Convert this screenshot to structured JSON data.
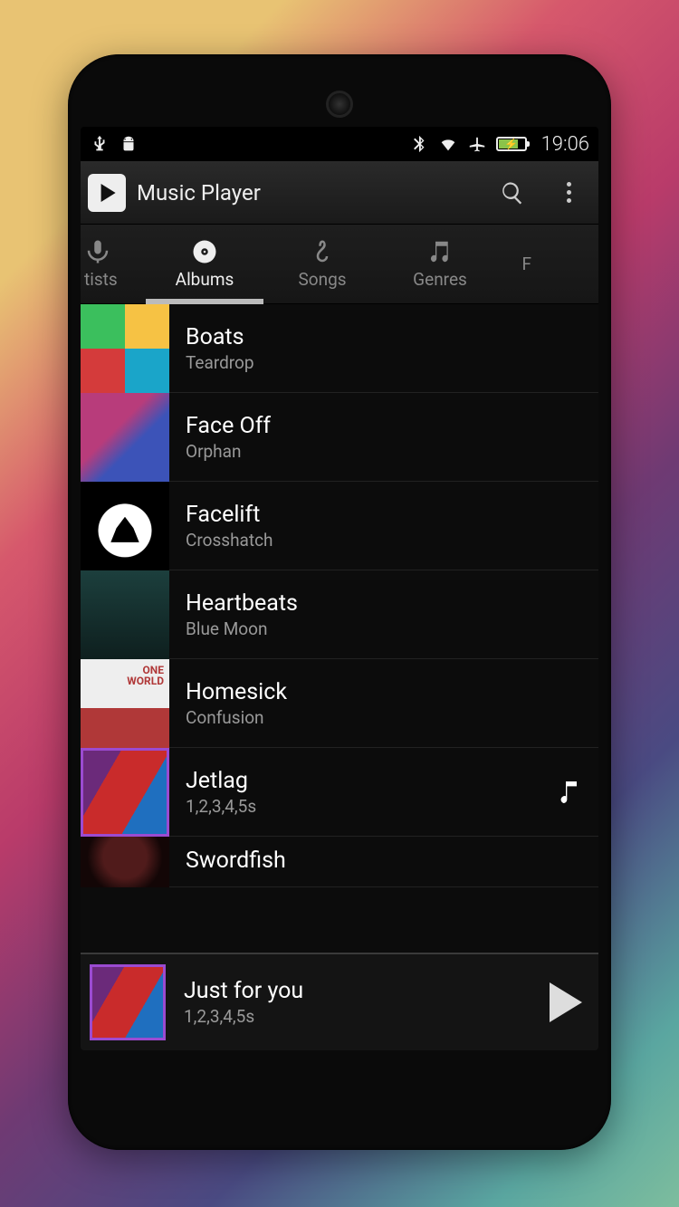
{
  "statusbar": {
    "clock": "19:06"
  },
  "actionbar": {
    "title": "Music Player"
  },
  "tabs": [
    {
      "label": "tists",
      "icon": "mic",
      "active": false,
      "partial": "left"
    },
    {
      "label": "Albums",
      "icon": "disc",
      "active": true
    },
    {
      "label": "Songs",
      "icon": "clef",
      "active": false
    },
    {
      "label": "Genres",
      "icon": "notes",
      "active": false
    },
    {
      "label": "F",
      "icon": "",
      "active": false,
      "partial": "right"
    }
  ],
  "albums": [
    {
      "title": "Boats",
      "artist": "Teardrop"
    },
    {
      "title": "Face Off",
      "artist": "Orphan"
    },
    {
      "title": "Facelift",
      "artist": "Crosshatch"
    },
    {
      "title": "Heartbeats",
      "artist": "Blue Moon"
    },
    {
      "title": "Homesick",
      "artist": "Confusion"
    },
    {
      "title": "Jetlag",
      "artist": "1,2,3,4,5s",
      "trailing_icon": "note"
    },
    {
      "title": "Swordfish",
      "artist": ""
    }
  ],
  "nowplaying": {
    "title": "Just for you",
    "artist": "1,2,3,4,5s"
  }
}
